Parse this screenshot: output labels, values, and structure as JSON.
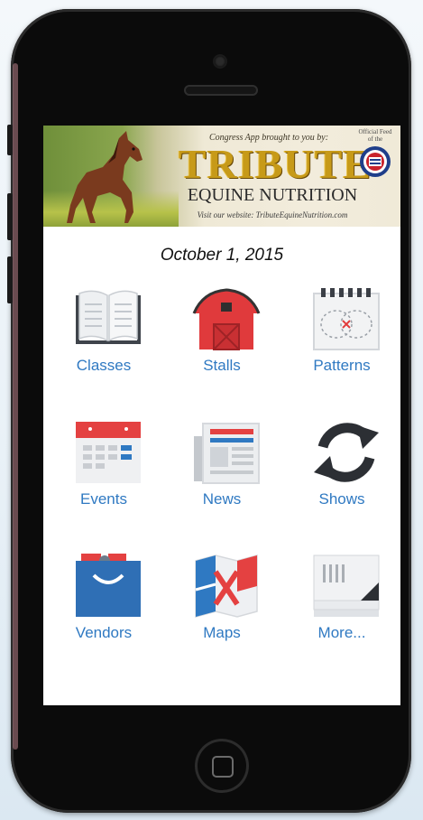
{
  "banner": {
    "tagline": "Congress App brought to you by:",
    "brand": "TRIBUTE",
    "subtitle": "EQUINE NUTRITION",
    "website": "Visit our website: TributeEquineNutrition.com",
    "seal_label": "Official Feed of the"
  },
  "date": "October 1, 2015",
  "menu": [
    {
      "label": "Classes",
      "icon": "open-book-icon"
    },
    {
      "label": "Stalls",
      "icon": "barn-icon"
    },
    {
      "label": "Patterns",
      "icon": "pattern-notepad-icon"
    },
    {
      "label": "Events",
      "icon": "calendar-icon"
    },
    {
      "label": "News",
      "icon": "newspaper-icon"
    },
    {
      "label": "Shows",
      "icon": "sync-arrows-icon"
    },
    {
      "label": "Vendors",
      "icon": "shopping-bag-icon"
    },
    {
      "label": "Maps",
      "icon": "folded-map-icon"
    },
    {
      "label": "More...",
      "icon": "stacked-pages-icon"
    }
  ],
  "colors": {
    "label_blue": "#2f79c2",
    "barn_red": "#e03a3c",
    "calendar_red": "#e44141",
    "vendor_blue": "#2f6fb5",
    "brand_gold": "#c79a18"
  }
}
